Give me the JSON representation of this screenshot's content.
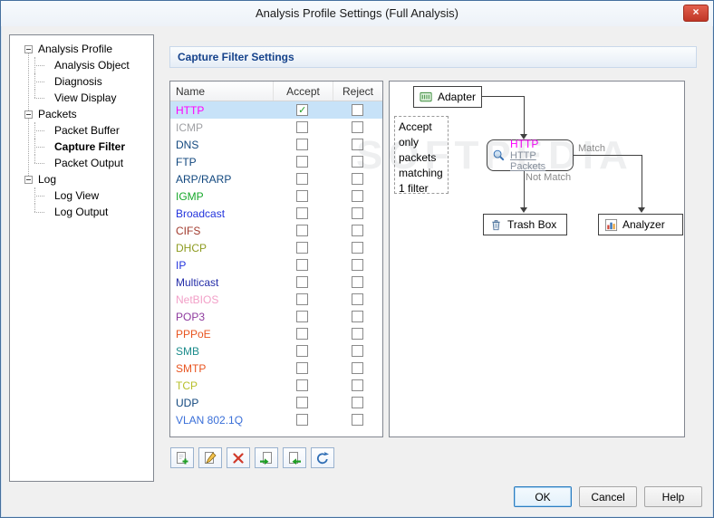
{
  "window": {
    "title": "Analysis Profile Settings (Full Analysis)"
  },
  "watermark": "SOFTPEDIA",
  "tree": {
    "items": [
      {
        "label": "Analysis Profile",
        "level": 0
      },
      {
        "label": "Analysis Object",
        "level": 1
      },
      {
        "label": "Diagnosis",
        "level": 1
      },
      {
        "label": "View Display",
        "level": 1,
        "last": true
      },
      {
        "label": "Packets",
        "level": 0
      },
      {
        "label": "Packet Buffer",
        "level": 1
      },
      {
        "label": "Capture Filter",
        "level": 1,
        "selected": true
      },
      {
        "label": "Packet Output",
        "level": 1,
        "last": true
      },
      {
        "label": "Log",
        "level": 0
      },
      {
        "label": "Log View",
        "level": 1
      },
      {
        "label": "Log Output",
        "level": 1,
        "last": true
      }
    ]
  },
  "main": {
    "header": "Capture Filter Settings",
    "table": {
      "columns": [
        "Name",
        "Accept",
        "Reject"
      ],
      "rows": [
        {
          "name": "HTTP",
          "color": "#FF00FF",
          "accept": true,
          "reject": false,
          "selected": true
        },
        {
          "name": "ICMP",
          "color": "#9FA0A4",
          "accept": false,
          "reject": false
        },
        {
          "name": "DNS",
          "color": "#11477E",
          "accept": false,
          "reject": false
        },
        {
          "name": "FTP",
          "color": "#11477E",
          "accept": false,
          "reject": false
        },
        {
          "name": "ARP/RARP",
          "color": "#11477E",
          "accept": false,
          "reject": false
        },
        {
          "name": "IGMP",
          "color": "#17A82B",
          "accept": false,
          "reject": false
        },
        {
          "name": "Broadcast",
          "color": "#2233DD",
          "accept": false,
          "reject": false
        },
        {
          "name": "CIFS",
          "color": "#A23C2F",
          "accept": false,
          "reject": false
        },
        {
          "name": "DHCP",
          "color": "#8E9C22",
          "accept": false,
          "reject": false
        },
        {
          "name": "IP",
          "color": "#2233DD",
          "accept": false,
          "reject": false
        },
        {
          "name": "Multicast",
          "color": "#252EA8",
          "accept": false,
          "reject": false
        },
        {
          "name": "NetBIOS",
          "color": "#F2A0C8",
          "accept": false,
          "reject": false
        },
        {
          "name": "POP3",
          "color": "#8E3A9E",
          "accept": false,
          "reject": false
        },
        {
          "name": "PPPoE",
          "color": "#E8541F",
          "accept": false,
          "reject": false
        },
        {
          "name": "SMB",
          "color": "#1C8C8C",
          "accept": false,
          "reject": false
        },
        {
          "name": "SMTP",
          "color": "#E8541F",
          "accept": false,
          "reject": false
        },
        {
          "name": "TCP",
          "color": "#B7BF2B",
          "accept": false,
          "reject": false
        },
        {
          "name": "UDP",
          "color": "#11477E",
          "accept": false,
          "reject": false
        },
        {
          "name": "VLAN 802.1Q",
          "color": "#3A6FD8",
          "accept": false,
          "reject": false
        }
      ]
    },
    "toolbar": [
      {
        "name": "add"
      },
      {
        "name": "edit"
      },
      {
        "name": "delete"
      },
      {
        "name": "import"
      },
      {
        "name": "export"
      },
      {
        "name": "restore"
      }
    ]
  },
  "diagram": {
    "adapter": "Adapter",
    "note": "Accept only packets matching 1 filter",
    "filter_name": "HTTP",
    "filter_desc": "HTTP Packets",
    "match": "Match",
    "not_match": "Not Match",
    "trash": "Trash Box",
    "analyzer": "Analyzer"
  },
  "footer": {
    "ok": "OK",
    "cancel": "Cancel",
    "help": "Help"
  }
}
